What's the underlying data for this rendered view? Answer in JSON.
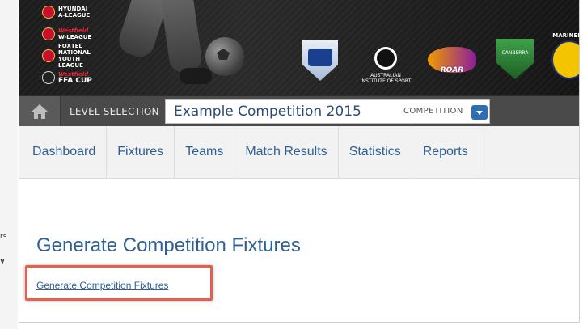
{
  "left_slice": {
    "fragment_1": "rs",
    "fragment_2": "y"
  },
  "header": {
    "brands": [
      {
        "line1": "HYUNDAI",
        "line2": "A-LEAGUE"
      },
      {
        "line1": "Westfield",
        "line2": "W-LEAGUE"
      },
      {
        "line1": "FOXTEL NATIONAL",
        "line2": "YOUTH LEAGUE"
      },
      {
        "line1": "Westfield",
        "line2": "FFA CUP"
      }
    ],
    "logos": {
      "ais": "AUSTRALIAN INSTITUTE OF SPORT",
      "roar": "ROAR",
      "canberra": "CANBERRA",
      "mariners": "MARINERS"
    }
  },
  "level_bar": {
    "label": "LEVEL SELECTION",
    "selected_value": "Example Competition 2015",
    "level_tag": "COMPETITION"
  },
  "nav": {
    "tabs": [
      "Dashboard",
      "Fixtures",
      "Teams",
      "Match Results",
      "Statistics",
      "Reports"
    ]
  },
  "content": {
    "heading": "Generate Competition Fixtures",
    "link_text": "Generate Competition Fixtures"
  },
  "colors": {
    "accent": "#2e5f96",
    "highlight": "#e2624f",
    "bar": "#4a4a4a"
  }
}
